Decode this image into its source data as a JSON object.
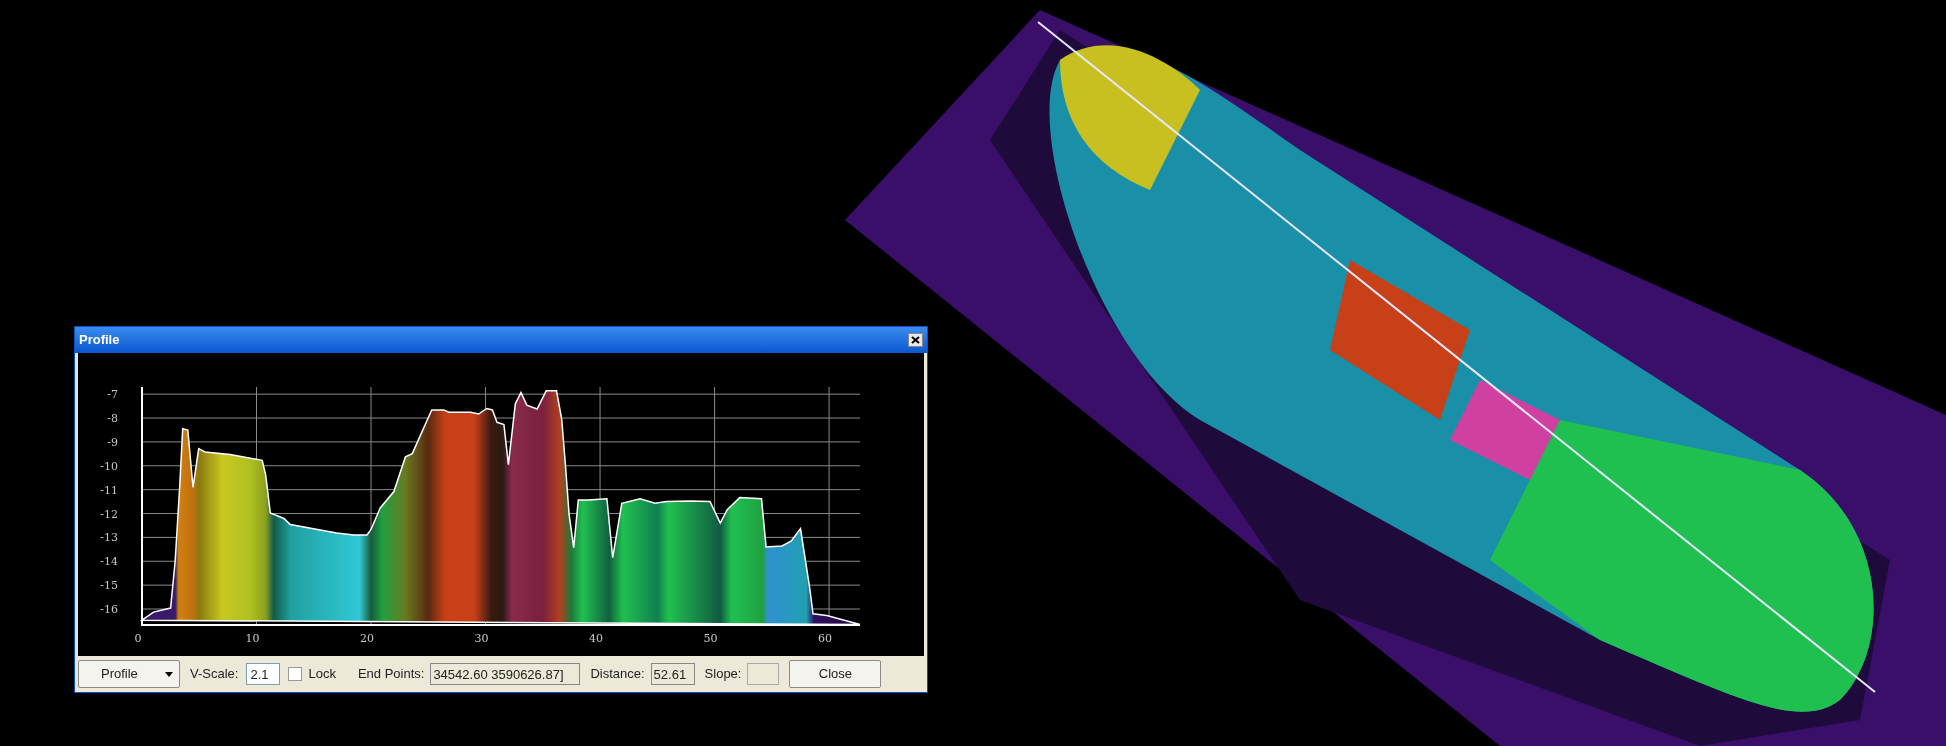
{
  "dialog": {
    "title": "Profile",
    "chart_data": {
      "type": "area",
      "xlim": [
        0,
        62.7
      ],
      "ylim": [
        -16.67,
        -6.7
      ],
      "grid": true,
      "xticks": [
        0,
        10,
        20,
        30,
        40,
        50,
        60
      ],
      "yticks": [
        -7,
        -8,
        -9,
        -10,
        -11,
        -12,
        -13,
        -14,
        -15,
        -16
      ],
      "x": [
        0,
        1,
        2.5,
        2.9,
        3.3,
        3.55,
        4,
        4.45,
        4.95,
        5.5,
        7.7,
        10.5,
        10.8,
        11.2,
        12.4,
        12.95,
        17,
        18.5,
        19.65,
        20,
        20.8,
        22,
        23,
        23.6,
        25.3,
        26.35,
        26.8,
        28.7,
        29.4,
        30.1,
        30.6,
        31,
        31.6,
        32,
        32.6,
        33.1,
        33.6,
        34.5,
        35.3,
        36.2,
        36.65,
        37,
        37.3,
        37.7,
        38.1,
        39,
        40.6,
        41.1,
        41.9,
        43.5,
        44.8,
        45.8,
        47.9,
        49.6,
        50.5,
        51.1,
        52.2,
        54.1,
        54.5,
        55.9,
        56.7,
        57.5,
        58.3,
        58.6,
        59.8,
        62.7
      ],
      "series": [
        {
          "values": [
            -16.47,
            -16.13,
            -15.96,
            -13.98,
            -10.8,
            -8.45,
            -8.5,
            -10.9,
            -9.28,
            -9.42,
            -9.53,
            -9.77,
            -10.39,
            -11.98,
            -12.21,
            -12.46,
            -12.81,
            -12.9,
            -12.9,
            -12.67,
            -11.77,
            -11.08,
            -9.63,
            -9.49,
            -7.66,
            -7.66,
            -7.76,
            -7.76,
            -7.83,
            -7.6,
            -7.66,
            -8.18,
            -8.27,
            -9.95,
            -7.41,
            -6.93,
            -7.46,
            -7.62,
            -6.86,
            -6.86,
            -8.04,
            -10.12,
            -12.05,
            -13.43,
            -11.43,
            -11.43,
            -11.38,
            -13.85,
            -11.57,
            -11.38,
            -11.57,
            -11.5,
            -11.47,
            -11.5,
            -12.4,
            -11.84,
            -11.33,
            -11.38,
            -13.4,
            -13.36,
            -13.15,
            -12.63,
            -15.09,
            -16.2,
            -16.27,
            -16.65
          ]
        }
      ]
    },
    "toolbar": {
      "profile_button": "Profile",
      "vscale_label": "V-Scale:",
      "vscale_value": "2.1",
      "lock": {
        "label": "Lock",
        "checked": false
      },
      "endpoints_label": "End Points:",
      "endpoints_value": "34542.60 3590626.87]",
      "distance_label": "Distance:",
      "distance_value": "52.61",
      "slope_label": "Slope:",
      "slope_field": {
        "disabled": true
      },
      "close_button": "Close"
    }
  }
}
